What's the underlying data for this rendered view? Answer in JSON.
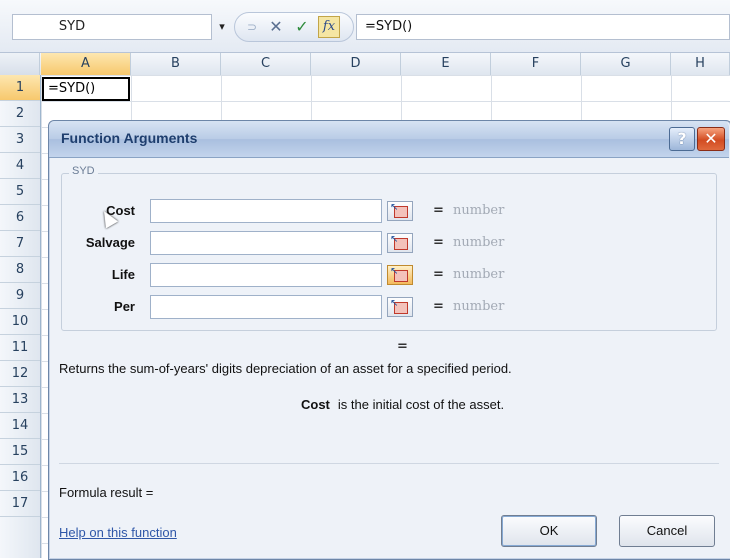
{
  "formula_bar": {
    "name_box": "SYD",
    "dropdown_arrow": "▾",
    "icons": [
      "undo-icon",
      "cancel-icon",
      "enter-icon",
      "insert-function-icon"
    ],
    "cancel_glyph": "✕",
    "enter_glyph": "✓",
    "fx_glyph": "fx",
    "formula": "=SYD()"
  },
  "sheet": {
    "columns": [
      "A",
      "B",
      "C",
      "D",
      "E",
      "F",
      "G",
      "H"
    ],
    "rows": [
      "1",
      "2",
      "3",
      "4",
      "5",
      "6",
      "7",
      "8",
      "9",
      "10",
      "11",
      "12",
      "13",
      "14",
      "15",
      "16",
      "17"
    ],
    "active_cell_value": "=SYD()"
  },
  "dialog": {
    "title": "Function Arguments",
    "help_glyph": "?",
    "close_glyph": "✕",
    "function_name": "SYD",
    "arguments": [
      {
        "label": "Cost",
        "value": "",
        "type": "number"
      },
      {
        "label": "Salvage",
        "value": "",
        "type": "number"
      },
      {
        "label": "Life",
        "value": "",
        "type": "number"
      },
      {
        "label": "Per",
        "value": "",
        "type": "number"
      }
    ],
    "equals": "=",
    "result_equals": "=",
    "description": "Returns the sum-of-years' digits depreciation of an asset for a specified period.",
    "arg_help_name": "Cost",
    "arg_help_text": "is the initial cost of the asset.",
    "formula_result": "Formula result =",
    "help_link": "Help on this function",
    "ok_label": "OK",
    "cancel_label": "Cancel"
  }
}
